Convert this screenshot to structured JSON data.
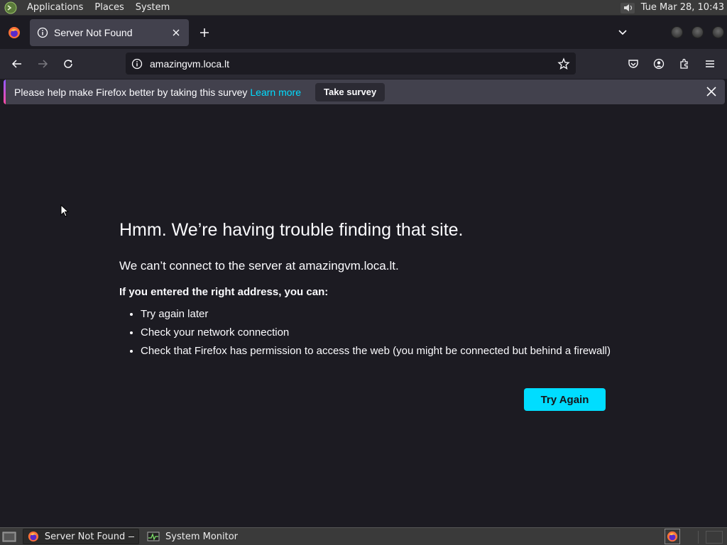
{
  "top_panel": {
    "menus": [
      "Applications",
      "Places",
      "System"
    ],
    "clock": "Tue Mar 28, 10:43"
  },
  "tab_bar": {
    "tab_title": "Server Not Found"
  },
  "nav_bar": {
    "url": "amazingvm.loca.lt"
  },
  "notification": {
    "message": "Please help make Firefox better by taking this survey",
    "link": "Learn more",
    "button": "Take survey"
  },
  "error": {
    "title": "Hmm. We’re having trouble finding that site.",
    "description": "We can’t connect to the server at amazingvm.loca.lt.",
    "subheading": "If you entered the right address, you can:",
    "suggestions": [
      "Try again later",
      "Check your network connection",
      "Check that Firefox has permission to access the web (you might be connected but behind a firewall)"
    ],
    "button": "Try Again"
  },
  "taskbar": {
    "tasks": [
      "Server Not Found —...",
      "System Monitor"
    ]
  },
  "colors": {
    "accent": "#00ddff",
    "background": "#1c1b22",
    "toolbar": "#2b2a33",
    "tab_selected": "#42414d"
  }
}
